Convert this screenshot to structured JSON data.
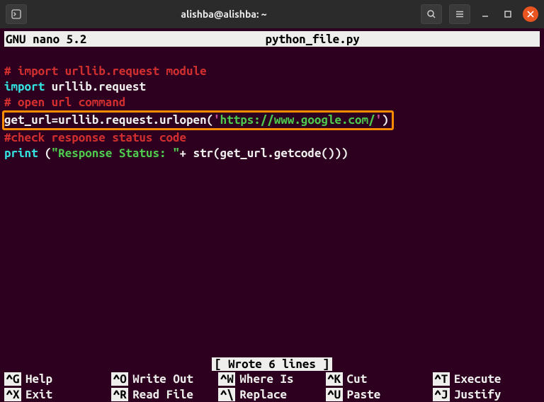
{
  "window": {
    "title": "alishba@alishba: ~"
  },
  "nano": {
    "app": "GNU nano 5.2",
    "filename": "python_file.py",
    "status": "[ Wrote 6 lines ]"
  },
  "code": {
    "l1_comment": "# import urllib.request module",
    "l2_kw": "import",
    "l2_rest": " urllib.request",
    "l3_comment": "# open url command",
    "l4_pre": "get_url=urllib.request.urlopen(",
    "l4_q1": "'",
    "l4_url": "https://www.google.com/",
    "l4_q2": "'",
    "l4_post": ")",
    "l5_comment": "#check response status code",
    "l6_kw": "print",
    "l6_sp": " (",
    "l6_str": "\"Response Status: \"",
    "l6_rest": "+ str(get_url.getcode()))"
  },
  "shortcuts": {
    "row1": [
      {
        "key": "^G",
        "label": "Help"
      },
      {
        "key": "^O",
        "label": "Write Out"
      },
      {
        "key": "^W",
        "label": "Where Is"
      },
      {
        "key": "^K",
        "label": "Cut"
      },
      {
        "key": "^T",
        "label": "Execute"
      }
    ],
    "row2": [
      {
        "key": "^X",
        "label": "Exit"
      },
      {
        "key": "^R",
        "label": "Read File"
      },
      {
        "key": "^\\",
        "label": "Replace"
      },
      {
        "key": "^U",
        "label": "Paste"
      },
      {
        "key": "^J",
        "label": "Justify"
      }
    ]
  }
}
